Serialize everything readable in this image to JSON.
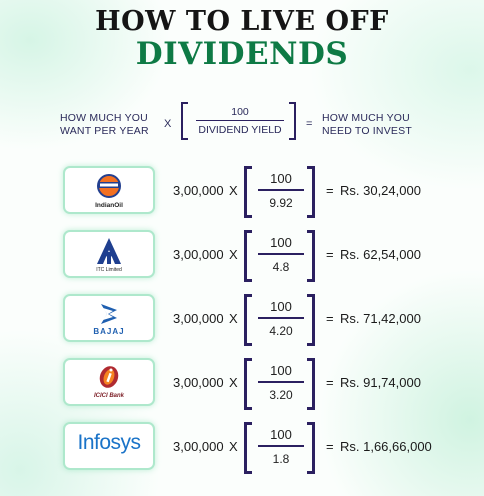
{
  "title": {
    "line1": "HOW TO LIVE OFF",
    "line2": "DIVIDENDS"
  },
  "formula": {
    "left_line1": "HOW MUCH YOU",
    "left_line2": "WANT PER YEAR",
    "times": "X",
    "numerator": "100",
    "denominator": "DIVIDEND YIELD",
    "equals": "=",
    "right_line1": "HOW MUCH YOU",
    "right_line2": "NEED TO INVEST"
  },
  "rows": [
    {
      "company": "IndianOil",
      "logo_icon": "indianoil-logo-icon",
      "amount": "3,00,000",
      "times": "X",
      "numerator": "100",
      "yield": "9.92",
      "equals": "=",
      "result": "Rs. 30,24,000"
    },
    {
      "company": "ITC Limited",
      "logo_icon": "itc-logo-icon",
      "amount": "3,00,000",
      "times": "X",
      "numerator": "100",
      "yield": "4.8",
      "equals": "=",
      "result": "Rs. 62,54,000"
    },
    {
      "company": "BAJAJ",
      "logo_icon": "bajaj-logo-icon",
      "amount": "3,00,000",
      "times": "X",
      "numerator": "100",
      "yield": "4.20",
      "equals": "=",
      "result": "Rs. 71,42,000"
    },
    {
      "company": "ICICI Bank",
      "logo_icon": "icici-logo-icon",
      "amount": "3,00,000",
      "times": "X",
      "numerator": "100",
      "yield": "3.20",
      "equals": "=",
      "result": "Rs. 91,74,000"
    },
    {
      "company": "Infosys",
      "logo_icon": "infosys-logo-icon",
      "amount": "3,00,000",
      "times": "X",
      "numerator": "100",
      "yield": "1.8",
      "equals": "=",
      "result": "Rs. 1,66,66,000"
    }
  ],
  "colors": {
    "title_dark": "#151515",
    "title_green": "#0e7a45",
    "bracket": "#2b2060",
    "logo_border": "#aee8cc"
  }
}
